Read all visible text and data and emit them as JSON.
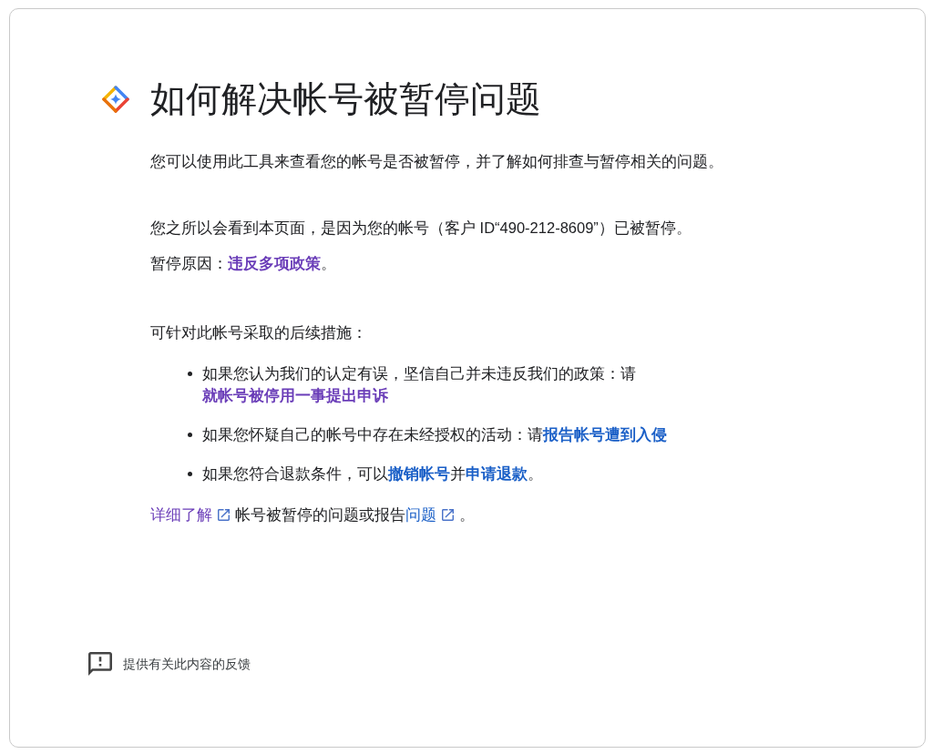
{
  "page": {
    "title": "如何解决帐号被暂停问题"
  },
  "intro": {
    "text": "您可以使用此工具来查看您的帐号是否被暂停，并了解如何排查与暂停相关的问题。"
  },
  "suspension": {
    "notice": "您之所以会看到本页面，是因为您的帐号（客户 ID“490-212-8609”）已被暂停。",
    "reason": [
      {
        "kind": "text",
        "text": "暂停原因："
      },
      {
        "kind": "link",
        "text": "违反多项政策",
        "visited": true
      },
      {
        "kind": "text",
        "text": "。"
      }
    ]
  },
  "next_steps": {
    "heading": "可针对此帐号采取的后续措施：",
    "items": [
      {
        "segments": [
          {
            "kind": "text",
            "text": "如果您认为我们的认定有误，坚信自己并未违反我们的政策：请"
          },
          {
            "kind": "link",
            "text": "就帐号被停用一事提出申诉",
            "visited": true
          }
        ]
      },
      {
        "segments": [
          {
            "kind": "text",
            "text": "如果您怀疑自己的帐号中存在未经授权的活动：请"
          },
          {
            "kind": "link",
            "text": "报告帐号遭到入侵",
            "visited": false
          }
        ]
      },
      {
        "segments": [
          {
            "kind": "text",
            "text": "如果您符合退款条件，可以"
          },
          {
            "kind": "link",
            "text": "撤销帐号",
            "visited": false
          },
          {
            "kind": "text",
            "text": "并"
          },
          {
            "kind": "link",
            "text": "申请退款",
            "visited": false
          },
          {
            "kind": "text",
            "text": "。"
          }
        ]
      }
    ]
  },
  "learn_more": {
    "segments": [
      {
        "kind": "external_link",
        "text": "详细了解",
        "visited": true
      },
      {
        "kind": "text",
        "text": "帐号被暂停的问题或报告"
      },
      {
        "kind": "external_link",
        "text": "问题",
        "visited": false
      },
      {
        "kind": "text",
        "text": "。"
      }
    ]
  },
  "feedback": {
    "label": "提供有关此内容的反馈"
  }
}
